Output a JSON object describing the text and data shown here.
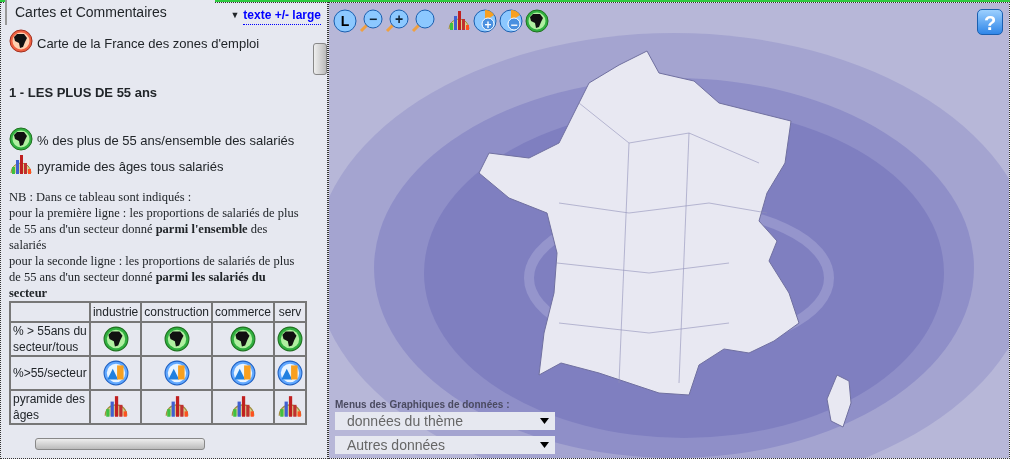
{
  "panel": {
    "tab": "Cartes et Commentaires",
    "toggle_arrow": "▼",
    "toggle_link": "texte +/- large"
  },
  "intro": {
    "kind": "map-red",
    "text": "Carte de la France des zones d'emploi"
  },
  "heading": "1 - LES PLUS DE 55 ans",
  "legend": [
    {
      "kind": "map-green",
      "text": "% des plus de 55 ans/ensemble des salariés"
    },
    {
      "kind": "pyramid",
      "text": "pyramide des âges tous salariés"
    }
  ],
  "note": [
    "NB : Dans ce tableau sont indiqués :",
    "pour la première ligne : les proportions de salariés de plus de 55 ans d'un secteur donné **parmi l'ensemble** des salariés",
    "pour la seconde ligne : les proportions de salariés de plus de 55 ans d'un secteur donné **parmi les salariés du secteur**"
  ],
  "table": {
    "columns": [
      "industrie",
      "construction",
      "commerce",
      "serv"
    ],
    "rows": [
      {
        "header": "% > 55ans du secteur/tous",
        "cells": [
          {
            "kind": "map-green"
          },
          {
            "kind": "map-green"
          },
          {
            "kind": "map-green"
          },
          {
            "kind": "map-green"
          }
        ]
      },
      {
        "header": "%>55/secteur",
        "cells": [
          {
            "kind": "chart-mix"
          },
          {
            "kind": "chart-mix"
          },
          {
            "kind": "chart-mix"
          },
          {
            "kind": "chart-mix"
          }
        ]
      },
      {
        "header": "pyramide des âges",
        "cells": [
          {
            "kind": "pyramid"
          },
          {
            "kind": "pyramid"
          },
          {
            "kind": "pyramid"
          },
          {
            "kind": "pyramid"
          }
        ]
      }
    ]
  },
  "toolbar": [
    {
      "kind": "letter",
      "label": "L"
    },
    {
      "kind": "zoom-out",
      "label": "−"
    },
    {
      "kind": "zoom-in",
      "label": "+"
    },
    {
      "kind": "zoom"
    },
    {
      "kind": "pyramid"
    },
    {
      "kind": "pie-plus",
      "label": "+"
    },
    {
      "kind": "pie-minus",
      "label": "−"
    },
    {
      "kind": "map-green"
    }
  ],
  "help": {
    "label": "?"
  },
  "menus": {
    "label": "Menus des Graphiques de données :",
    "selects": [
      "données du thème",
      "Autres données"
    ]
  }
}
